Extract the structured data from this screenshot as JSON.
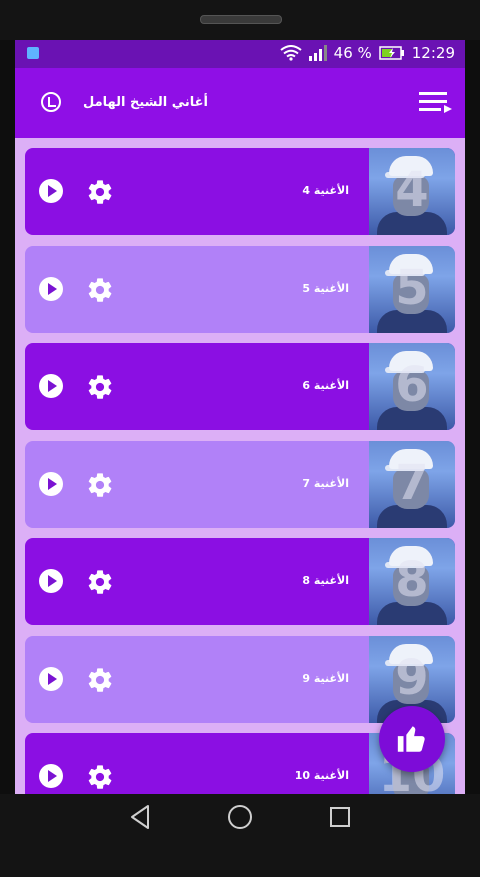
{
  "status_bar": {
    "battery_percent": "46 %",
    "time": "12:29"
  },
  "app_bar": {
    "title": "أغاني الشيخ الهامل"
  },
  "songs": [
    {
      "label": "الأغنية 4",
      "number": "4",
      "style": "dark"
    },
    {
      "label": "الأغنية 5",
      "number": "5",
      "style": "light"
    },
    {
      "label": "الأغنية 6",
      "number": "6",
      "style": "dark"
    },
    {
      "label": "الأغنية 7",
      "number": "7",
      "style": "light"
    },
    {
      "label": "الأغنية 8",
      "number": "8",
      "style": "dark"
    },
    {
      "label": "الأغنية 9",
      "number": "9",
      "style": "light"
    },
    {
      "label": "الأغنية 10",
      "number": "10",
      "style": "dark"
    }
  ],
  "icons": {
    "row_play": "play-circle-icon",
    "row_settings": "gear-icon",
    "fab": "thumbs-up-icon",
    "menu": "playlist-menu-icon",
    "nav": [
      "back-triangle-icon",
      "home-circle-icon",
      "recents-square-icon"
    ]
  },
  "colors": {
    "app_bar": "#8f0fe6",
    "status_bar": "#6a12b3",
    "row_dark": "#8b0fe3",
    "row_light": "#b181f8",
    "background": "#dcaff6",
    "fab": "#7d0cd8"
  }
}
